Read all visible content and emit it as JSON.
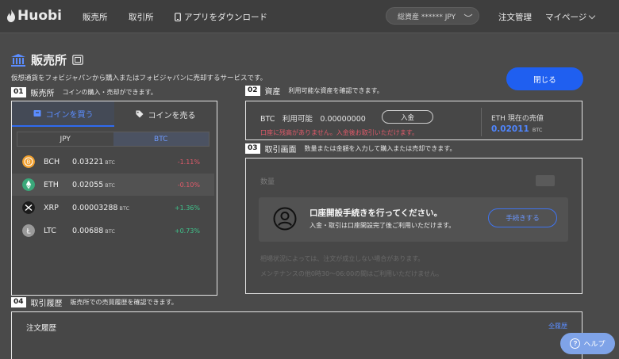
{
  "header": {
    "logo_text": "Huobi",
    "nav": [
      "販売所",
      "取引所"
    ],
    "download_label": "アプリをダウンロード",
    "assets_label": "総資産 ****** JPY",
    "order_mgmt": "注文管理",
    "mypage": "マイページ"
  },
  "page": {
    "title": "販売所",
    "subtitle": "仮想通貨をフォビジャパンから購入またはフォビジャパンに売却するサービスです。",
    "close_label": "閉じる"
  },
  "sections": {
    "s1": {
      "num": "01",
      "title": "販売所",
      "desc": "コインの購入・売却ができます。"
    },
    "s2": {
      "num": "02",
      "title": "資産",
      "desc": "利用可能な資産を確認できます。"
    },
    "s3": {
      "num": "03",
      "title": "取引画面",
      "desc": "数量または金額を入力して購入または売却できます。"
    },
    "s4": {
      "num": "04",
      "title": "取引履歴",
      "desc": "販売所での売買履歴を確認できます。"
    }
  },
  "trade_panel": {
    "buy_tab": "コインを買う",
    "sell_tab": "コインを売る",
    "currency_tabs": [
      "JPY",
      "BTC"
    ],
    "selected_currency": "BTC",
    "coins": [
      {
        "symbol": "BCH",
        "price": "0.03221",
        "unit": "BTC",
        "change": "-1.11%",
        "dir": "neg",
        "color": "#f0a030"
      },
      {
        "symbol": "ETH",
        "price": "0.02055",
        "unit": "BTC",
        "change": "-0.10%",
        "dir": "neg",
        "color": "#3aa87a"
      },
      {
        "symbol": "XRP",
        "price": "0.00003288",
        "unit": "BTC",
        "change": "+1.36%",
        "dir": "pos",
        "color": "#1c1c1c"
      },
      {
        "symbol": "LTC",
        "price": "0.00688",
        "unit": "BTC",
        "change": "+0.73%",
        "dir": "pos",
        "color": "#9a9a9a"
      }
    ]
  },
  "assets_panel": {
    "btc_available": "BTC　利用可能　0.00000000",
    "deposit_label": "入金",
    "warning": "口座に残高がありません。入金後お取引いただけます。",
    "eth_label": "ETH 現在の売値",
    "eth_price": "0.02011",
    "eth_unit": "BTC"
  },
  "exchange_panel": {
    "qty_label": "数量",
    "overlay_title": "口座開設手続きを行ってください。",
    "overlay_desc": "入金・取引は口座開設完了後ご利用いただけます。",
    "proc_label": "手続きする",
    "note1": "相場状況によっては、注文が成立しない場合があります。",
    "note2": "メンテナンスの他0時30〜06:00の間はご利用いただけません。"
  },
  "history_panel": {
    "title": "注文履歴",
    "all_label": "全履歴"
  },
  "help": {
    "label": "ヘルプ"
  },
  "colors": {
    "accent": "#1f5ff0",
    "negative": "#e25a6a",
    "positive": "#3fc48c"
  }
}
